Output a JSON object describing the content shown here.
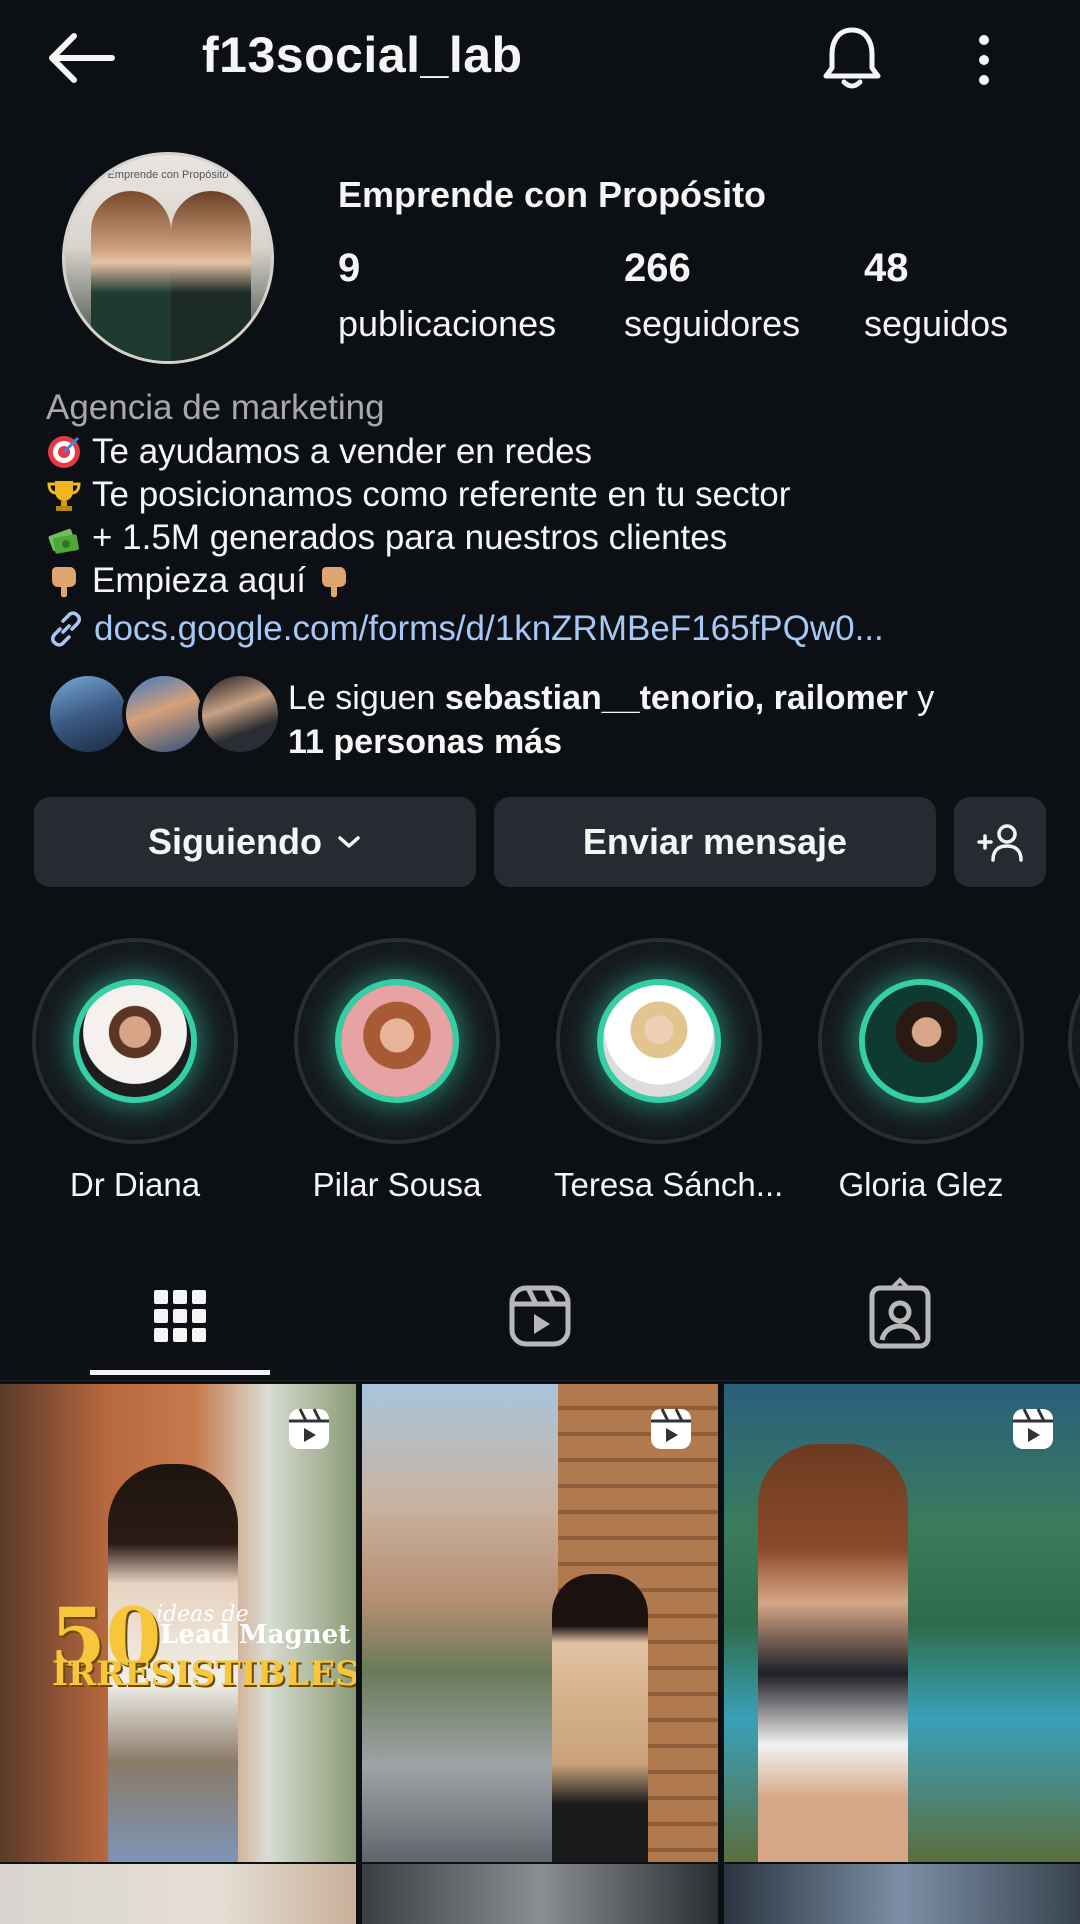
{
  "header": {
    "username": "f13social_lab"
  },
  "profile": {
    "full_name": "Emprende con Propósito",
    "avatar_caption": "Emprende con Propósito",
    "stats": [
      {
        "count": "9",
        "label": "publicaciones"
      },
      {
        "count": "266",
        "label": "seguidores"
      },
      {
        "count": "48",
        "label": "seguidos"
      }
    ],
    "category": "Agencia de marketing",
    "bio_lines": [
      {
        "icon": "target-emoji",
        "text": "Te ayudamos a vender en redes"
      },
      {
        "icon": "trophy-emoji",
        "text": "Te posicionamos como referente en tu sector"
      },
      {
        "icon": "money-emoji",
        "text": "+ 1.5M generados para nuestros clientes"
      },
      {
        "icon": "pointing-down-emoji",
        "text": "Empieza aquí",
        "trailing_icon": "pointing-down-emoji"
      }
    ],
    "link": "docs.google.com/forms/d/1knZRMBeF165fPQw0..."
  },
  "followed_by": {
    "prefix": "Le siguen ",
    "names": "sebastian__tenorio, railomer",
    "connector": " y",
    "others": "11 personas más"
  },
  "actions": {
    "following_label": "Siguiendo",
    "message_label": "Enviar mensaje"
  },
  "highlights": [
    {
      "label": "Dr Diana"
    },
    {
      "label": "Pilar Sousa"
    },
    {
      "label": "Teresa Sánch..."
    },
    {
      "label": "Gloria Glez"
    }
  ],
  "tabs": [
    "grid-icon",
    "reels-icon",
    "tagged-icon"
  ],
  "posts": [
    {
      "overlay_number": "50",
      "overlay_small": "ideas de",
      "overlay_title": "Lead Magnet",
      "overlay_bottom": "IRRESISTIBLES",
      "type": "reel"
    },
    {
      "type": "reel"
    },
    {
      "type": "reel"
    }
  ],
  "colors": {
    "background": "#0c1014",
    "button": "#262a31",
    "link": "#a7c8f5",
    "highlight_glow": "#35cfa6"
  }
}
